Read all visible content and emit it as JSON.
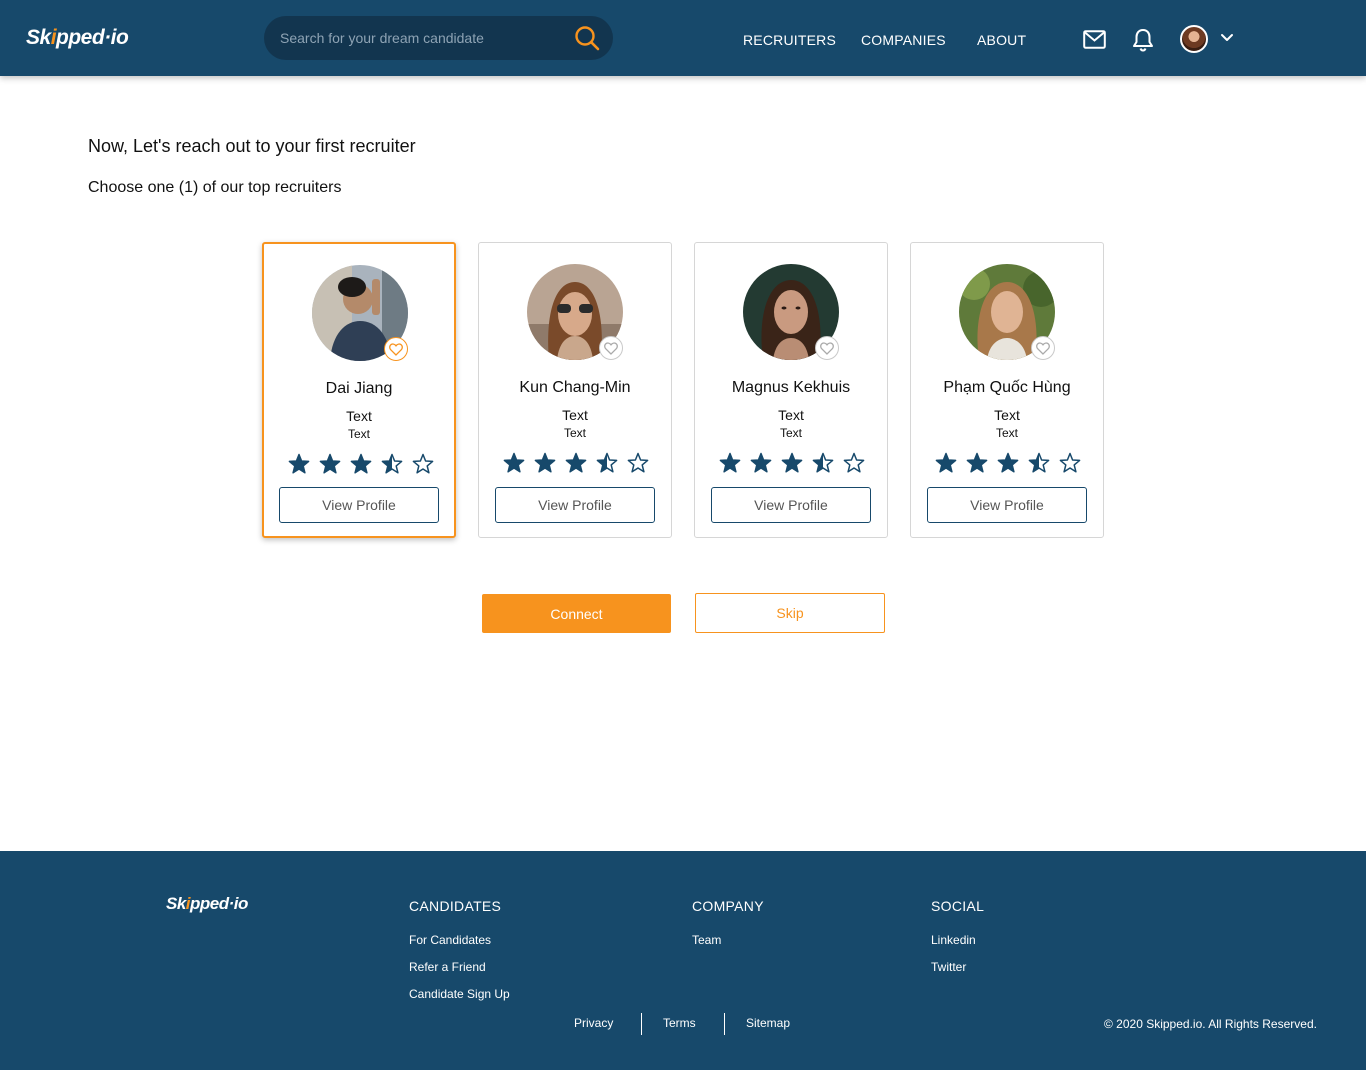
{
  "header": {
    "logo": {
      "prefix": "Sk",
      "mark": "i",
      "suffix": "pped·io"
    },
    "search": {
      "placeholder": "Search for your dream candidate",
      "value": ""
    },
    "nav": [
      "RECRUITERS",
      "COMPANIES",
      "ABOUT"
    ],
    "icons": [
      "mail-icon",
      "bell-icon",
      "avatar",
      "chevron-down-icon"
    ]
  },
  "main": {
    "title": "Now, Let's reach out to your first recruiter",
    "subtitle": "Choose one (1) of our top recruiters",
    "cards": [
      {
        "name": "Dai Jiang",
        "line1": "Text",
        "line2": "Text",
        "rating": 3.5,
        "max_rating": 5,
        "button": "View Profile",
        "selected": true
      },
      {
        "name": "Kun Chang-Min",
        "line1": "Text",
        "line2": "Text",
        "rating": 3.5,
        "max_rating": 5,
        "button": "View Profile",
        "selected": false
      },
      {
        "name": "Magnus Kekhuis",
        "line1": "Text",
        "line2": "Text",
        "rating": 3.5,
        "max_rating": 5,
        "button": "View Profile",
        "selected": false
      },
      {
        "name": "Phạm Quốc Hùng",
        "line1": "Text",
        "line2": "Text",
        "rating": 3.5,
        "max_rating": 5,
        "button": "View Profile",
        "selected": false
      }
    ],
    "connect_label": "Connect",
    "skip_label": "Skip"
  },
  "footer": {
    "logo": {
      "prefix": "Sk",
      "mark": "i",
      "suffix": "pped·io"
    },
    "candidates": {
      "heading": "CANDIDATES",
      "links": [
        "For Candidates",
        "Refer a Friend",
        "Candidate Sign Up"
      ]
    },
    "company": {
      "heading": "COMPANY",
      "links": [
        "Team"
      ]
    },
    "social": {
      "heading": "SOCIAL",
      "links": [
        "Linkedin",
        "Twitter"
      ]
    },
    "bottom_links": [
      "Privacy",
      "Terms",
      "Sitemap"
    ],
    "copyright": "© 2020 Skipped.io. All Rights Reserved."
  },
  "colors": {
    "primary": "#17496b",
    "accent": "#f7931e",
    "star": "#17496b"
  }
}
